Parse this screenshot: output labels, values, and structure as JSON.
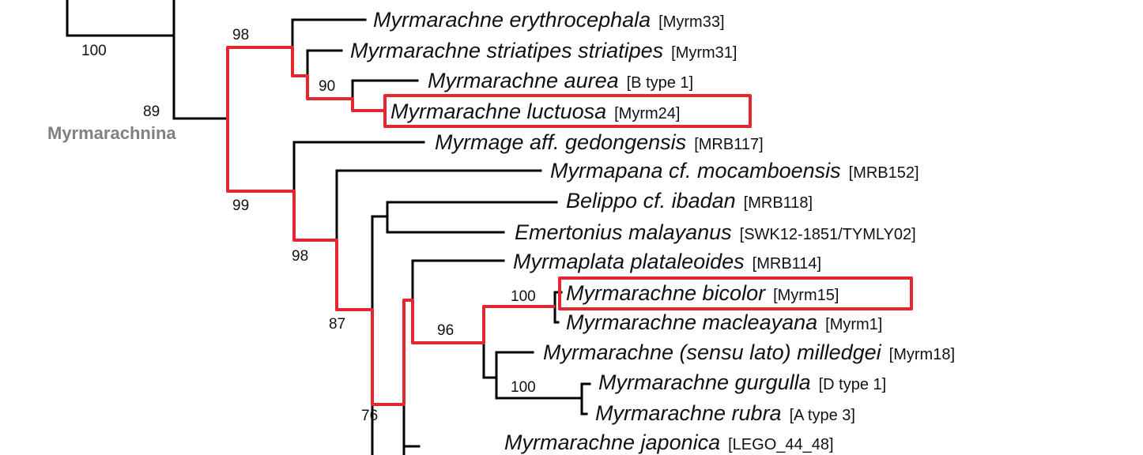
{
  "clade_label": "Myrmarachnina",
  "colors": {
    "highlight": "#e3262f",
    "branch": "#000000",
    "clade_label": "#808080"
  },
  "taxa": [
    {
      "name": "Myrmarachne erythrocephala",
      "code": "[Myrm33]"
    },
    {
      "name": "Myrmarachne striatipes striatipes",
      "code": "[Myrm31]"
    },
    {
      "name": "Myrmarachne aurea",
      "code": "[B type 1]"
    },
    {
      "name": "Myrmarachne luctuosa",
      "code": "[Myrm24]"
    },
    {
      "name": "Myrmage aff. gedongensis",
      "code": "[MRB117]"
    },
    {
      "name": "Myrmapana cf. mocamboensis",
      "code": "[MRB152]"
    },
    {
      "name": "Belippo cf. ibadan",
      "code": "[MRB118]"
    },
    {
      "name": "Emertonius malayanus",
      "code": "[SWK12-1851/TYMLY02]"
    },
    {
      "name": "Myrmaplata plataleoides",
      "code": "[MRB114]"
    },
    {
      "name": "Myrmarachne bicolor",
      "code": "[Myrm15]"
    },
    {
      "name": "Myrmarachne macleayana",
      "code": "[Myrm1]"
    },
    {
      "name": "Myrmarachne (sensu lato) milledgei",
      "code": "[Myrm18]"
    },
    {
      "name": "Myrmarachne gurgulla",
      "code": "[D type 1]"
    },
    {
      "name": "Myrmarachne rubra",
      "code": "[A type 3]"
    },
    {
      "name": "Myrmarachne japonica",
      "code": "[LEGO_44_48]"
    }
  ],
  "support_values": [
    "100",
    "98",
    "89",
    "90",
    "99",
    "98",
    "87",
    "76",
    "96",
    "100",
    "100"
  ]
}
